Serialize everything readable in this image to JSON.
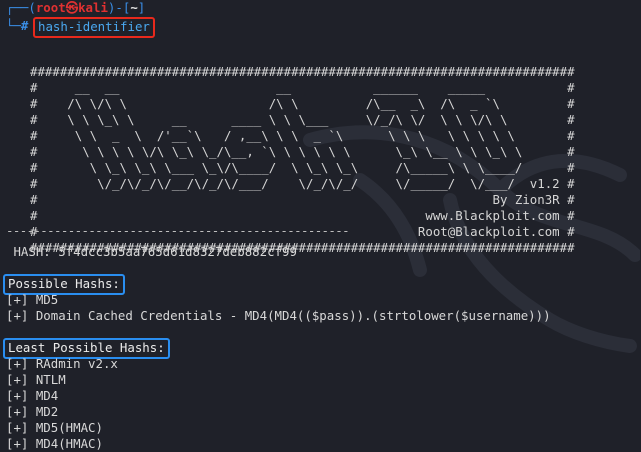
{
  "prompt": {
    "corner_top": "┌──(",
    "user": "root",
    "at": "㉿",
    "host": "kali",
    "sep": ")-[",
    "dir": "~",
    "close": "]",
    "corner_bottom": "└─",
    "hash": "#",
    "command": "hash-identifier"
  },
  "banner": {
    "lines": [
      "#########################################################################",
      "#     __  __                     __           ______    _____           #",
      "#    /\\ \\/\\ \\                   /\\ \\         /\\__  _\\  /\\  _ `\\         #",
      "#    \\ \\ \\_\\ \\     __      ____ \\ \\ \\___     \\/_/\\ \\/  \\ \\ \\/\\ \\        #",
      "#     \\ \\  _  \\  /'__`\\   / ,__\\ \\ \\  _ `\\      \\ \\ \\   \\ \\ \\ \\ \\       #",
      "#      \\ \\ \\ \\ \\/\\ \\_\\ \\_/\\__, `\\ \\ \\ \\ \\ \\      \\_\\ \\__ \\ \\ \\_\\ \\      #",
      "#       \\ \\_\\ \\_\\ \\___ \\_\\/\\____/  \\ \\_\\ \\_\\     /\\_____\\ \\ \\____/      #",
      "#        \\/_/\\/_/\\/__/\\/_/\\/___/    \\/_/\\/_/     \\/_____/  \\/___/  v1.2 #",
      "#                                                             By Zion3R #",
      "#                                                    www.Blackploit.com #",
      "#                                                   Root@Blackploit.com #",
      "#########################################################################"
    ]
  },
  "rule_text": "--------------------------------------------------",
  "hash_line": " HASH: 5f4dcc3b5aa765d61d8327deb882cf99",
  "possible": {
    "title": "Possible Hashs:",
    "items": [
      "[+] MD5",
      "[+] Domain Cached Credentials - MD4(MD4(($pass)).(strtolower($username)))"
    ]
  },
  "least": {
    "title": "Least Possible Hashs:",
    "items": [
      "[+] RAdmin v2.x",
      "[+] NTLM",
      "[+] MD4",
      "[+] MD2",
      "[+] MD5(HMAC)",
      "[+] MD4(HMAC)"
    ]
  },
  "colors": {
    "background": "#1f2129",
    "prompt_blue": "#3a8ee6",
    "prompt_red": "#e03131",
    "highlight_red": "#e8291c",
    "highlight_blue": "#2a8ef0"
  }
}
